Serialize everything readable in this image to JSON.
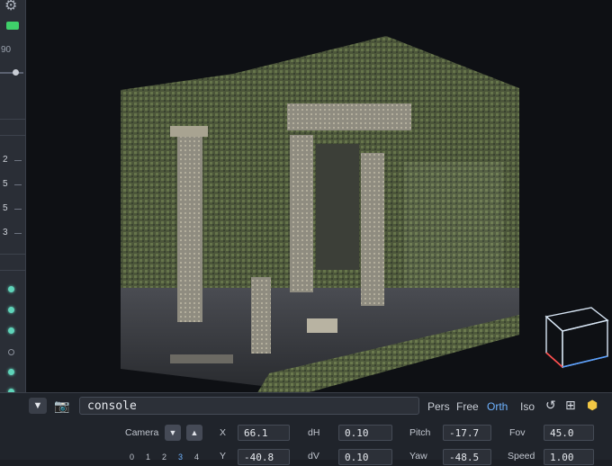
{
  "left_panel": {
    "value_label": "90",
    "numbers": [
      "2",
      "5",
      "5",
      "3"
    ]
  },
  "viewport": {
    "scene_description_icon": "voxel-temple-ruins",
    "gizmo": "orientation-cube-icon"
  },
  "toolbar": {
    "console_text": "console",
    "modes": [
      "Pers",
      "Free",
      "Orth",
      "Iso"
    ],
    "active_mode": "Orth",
    "icons": [
      "undo-icon",
      "grid-icon",
      "cube-icon"
    ]
  },
  "camera": {
    "label": "Camera",
    "presets": [
      "0",
      "1",
      "2",
      "3",
      "4"
    ],
    "fields": {
      "x": {
        "label": "X",
        "value": "66.1"
      },
      "y": {
        "label": "Y",
        "value": "-40.8"
      },
      "dh": {
        "label": "dH",
        "value": "0.10"
      },
      "dv": {
        "label": "dV",
        "value": "0.10"
      },
      "pitch": {
        "label": "Pitch",
        "value": "-17.7"
      },
      "yaw": {
        "label": "Yaw",
        "value": "-48.5"
      },
      "fov": {
        "label": "Fov",
        "value": "45.0"
      },
      "speed": {
        "label": "Speed",
        "value": "1.00"
      }
    }
  },
  "colors": {
    "accent": "#6fb3ff",
    "indicator": "#3fcf6a",
    "toggle": "#5fd3b9"
  }
}
